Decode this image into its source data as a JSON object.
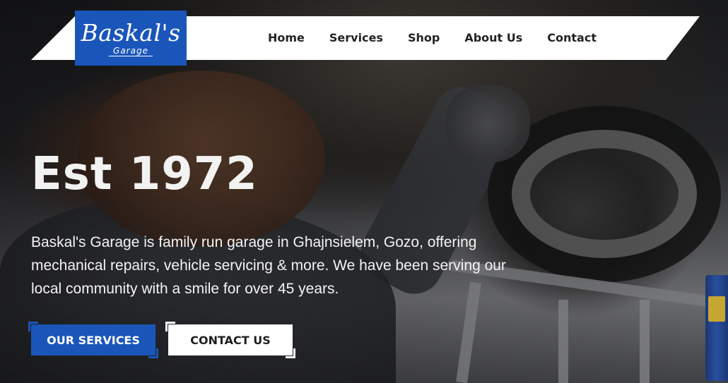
{
  "brand": {
    "name": "Baskal's",
    "sub": "Garage",
    "color": "#1a56b9"
  },
  "nav": {
    "items": [
      {
        "label": "Home"
      },
      {
        "label": "Services"
      },
      {
        "label": "Shop"
      },
      {
        "label": "About Us"
      },
      {
        "label": "Contact"
      }
    ]
  },
  "hero": {
    "heading": "Est 1972",
    "description": "Baskal's Garage is family run garage in Ghajnsielem, Gozo, offering mechanical repairs, vehicle servicing & more. We have been serving our local community with a smile for over 45 years.",
    "buttons": {
      "primary": "OUR SERVICES",
      "secondary": "CONTACT US"
    },
    "background_image": "mechanic-under-car-photo"
  }
}
